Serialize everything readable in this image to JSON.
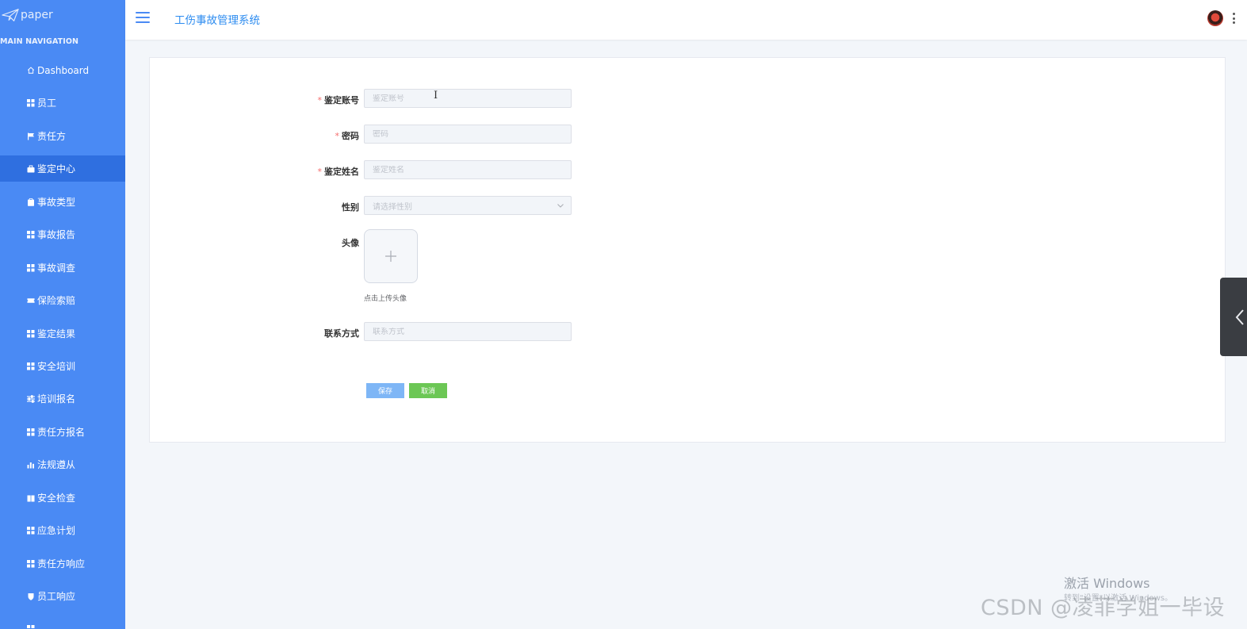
{
  "brand": {
    "logo_text": "paper"
  },
  "sidebar": {
    "section_title": "MAIN NAVIGATION",
    "items": [
      {
        "label": "Dashboard",
        "icon": "home-icon"
      },
      {
        "label": "员工",
        "icon": "grid-icon"
      },
      {
        "label": "责任方",
        "icon": "flag-icon"
      },
      {
        "label": "鉴定中心",
        "icon": "briefcase-icon",
        "active": true
      },
      {
        "label": "事故类型",
        "icon": "clipboard-icon"
      },
      {
        "label": "事故报告",
        "icon": "grid-icon"
      },
      {
        "label": "事故调查",
        "icon": "grid-icon"
      },
      {
        "label": "保险索赔",
        "icon": "ticket-icon"
      },
      {
        "label": "鉴定结果",
        "icon": "grid-icon"
      },
      {
        "label": "安全培训",
        "icon": "grid-icon"
      },
      {
        "label": "培训报名",
        "icon": "sliders-icon"
      },
      {
        "label": "责任方报名",
        "icon": "grid-icon"
      },
      {
        "label": "法规遵从",
        "icon": "bar-chart-icon"
      },
      {
        "label": "安全检查",
        "icon": "book-icon"
      },
      {
        "label": "应急计划",
        "icon": "grid-icon"
      },
      {
        "label": "责任方响应",
        "icon": "grid-icon"
      },
      {
        "label": "员工响应",
        "icon": "shield-icon"
      }
    ]
  },
  "header": {
    "title": "工伤事故管理系统"
  },
  "form": {
    "account": {
      "label": "鉴定账号",
      "placeholder": "鉴定账号",
      "required": true
    },
    "password": {
      "label": "密码",
      "placeholder": "密码",
      "required": true
    },
    "name": {
      "label": "鉴定姓名",
      "placeholder": "鉴定姓名",
      "required": true
    },
    "gender": {
      "label": "性别",
      "placeholder": "请选择性别"
    },
    "avatar": {
      "label": "头像",
      "hint": "点击上传头像"
    },
    "contact": {
      "label": "联系方式",
      "placeholder": "联系方式"
    },
    "save_label": "保存",
    "cancel_label": "取消"
  },
  "watermark": {
    "activate_title": "激活 Windows",
    "activate_sub": "转到\"设置\"以激活 Windows。",
    "csdn": "CSDN @凌菲学姐一毕设"
  },
  "colors": {
    "sidebar_bg": "#4a8af4",
    "sidebar_active": "#2f6fe0",
    "title_blue": "#2d8cf0",
    "save_btn": "#7eb6f6",
    "cancel_btn": "#6cc755",
    "required": "#f56c6c"
  }
}
